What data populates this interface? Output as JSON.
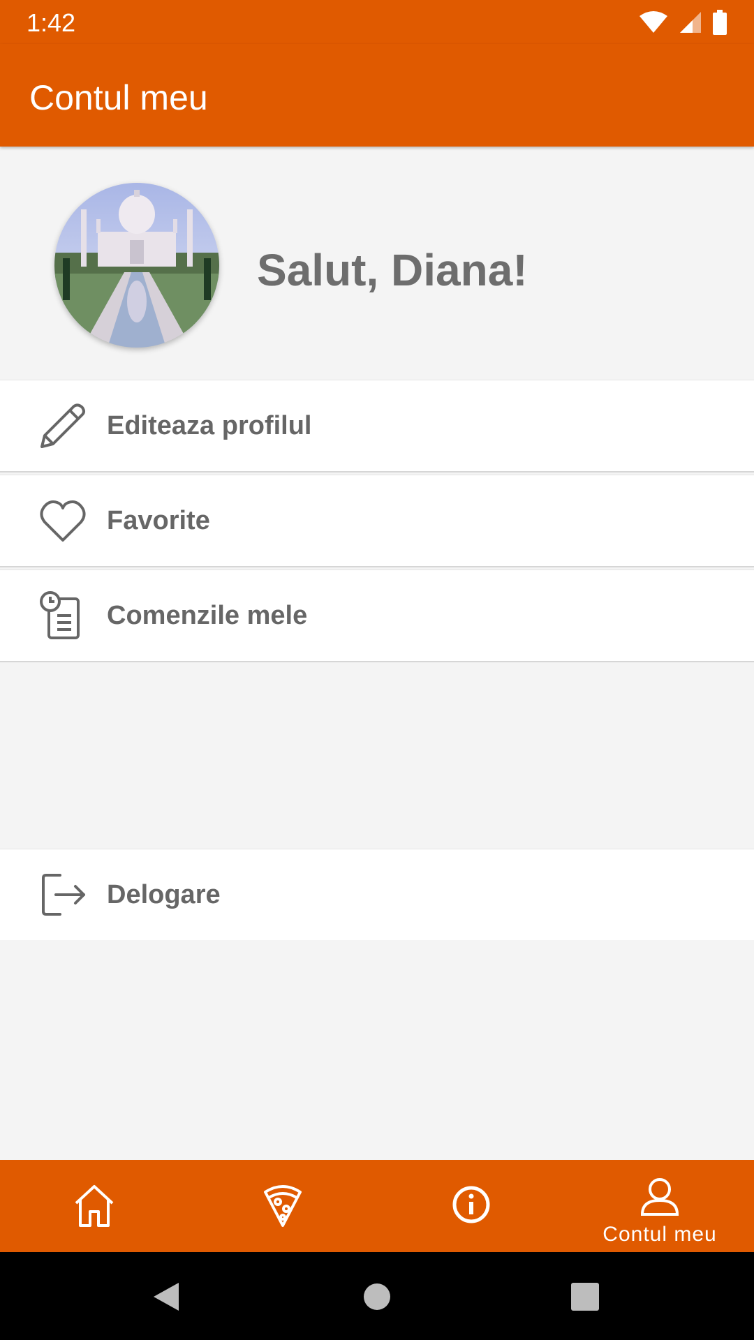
{
  "status_bar": {
    "time": "1:42"
  },
  "app_bar": {
    "title": "Contul meu"
  },
  "profile": {
    "greeting": "Salut, Diana!"
  },
  "menu": {
    "items": [
      {
        "label": "Editeaza profilul",
        "icon": "pencil-icon"
      },
      {
        "label": "Favorite",
        "icon": "heart-icon"
      },
      {
        "label": "Comenzile mele",
        "icon": "order-history-icon"
      }
    ],
    "logout": {
      "label": "Delogare",
      "icon": "logout-icon"
    }
  },
  "bottom_nav": {
    "items": [
      {
        "icon": "home-icon",
        "label": ""
      },
      {
        "icon": "pizza-icon",
        "label": ""
      },
      {
        "icon": "info-icon",
        "label": ""
      },
      {
        "icon": "user-icon",
        "label": "Contul meu"
      }
    ],
    "active_index": 3
  },
  "colors": {
    "primary": "#e05a00",
    "background": "#f4f4f4",
    "text_muted": "#666666"
  }
}
